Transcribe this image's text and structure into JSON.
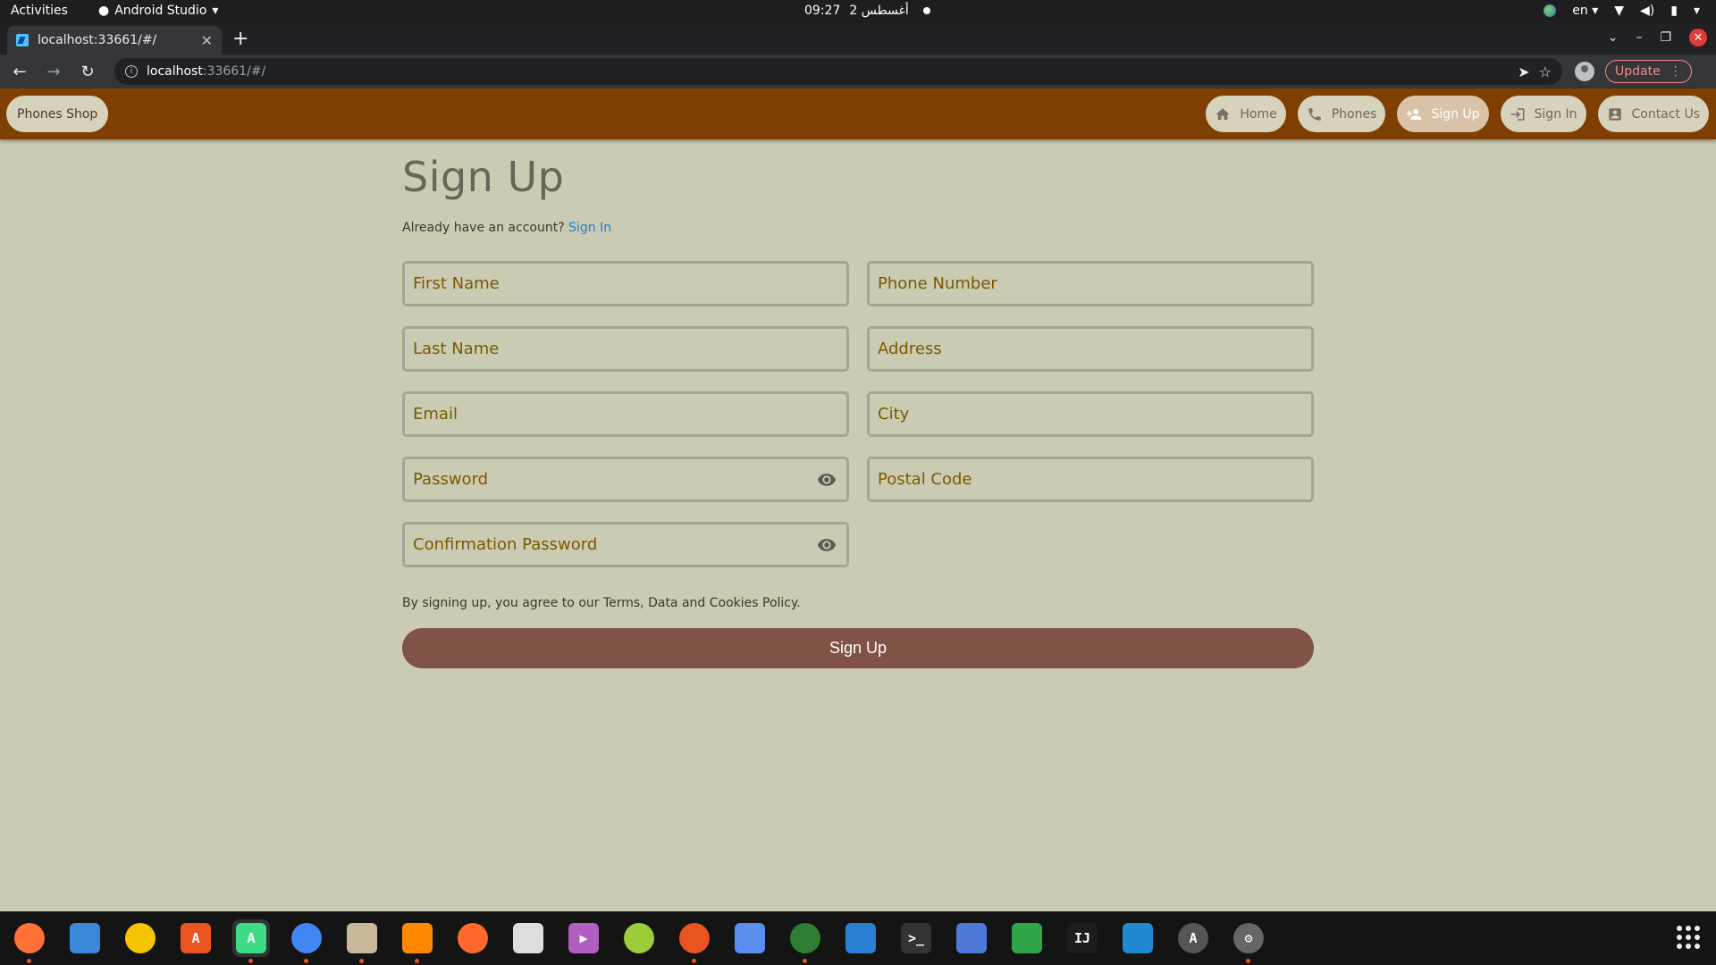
{
  "system_bar": {
    "activities": "Activities",
    "app_menu": "Android Studio",
    "time": "09:27",
    "date": "2 أغسطس",
    "lang": "en"
  },
  "browser": {
    "tab_title": "localhost:33661/#/",
    "url_host": "localhost",
    "url_rest": ":33661/#/",
    "update_label": "Update"
  },
  "navbar": {
    "brand": "Phones Shop",
    "items": [
      {
        "label": "Home",
        "icon": "home-icon"
      },
      {
        "label": "Phones",
        "icon": "phone-icon"
      },
      {
        "label": "Sign Up",
        "icon": "person-add-icon",
        "active": true
      },
      {
        "label": "Sign In",
        "icon": "login-icon"
      },
      {
        "label": "Contact Us",
        "icon": "contact-icon"
      }
    ]
  },
  "form": {
    "title": "Sign Up",
    "already_text": "Already have an account? ",
    "signin_link": "Sign In",
    "fields": {
      "first_name": "First Name",
      "phone_number": "Phone Number",
      "last_name": "Last Name",
      "address": "Address",
      "email": "Email",
      "city": "City",
      "password": "Password",
      "postal_code": "Postal Code",
      "confirmation_password": "Confirmation Password"
    },
    "terms": "By signing up, you agree to our Terms, Data and Cookies Policy.",
    "submit": "Sign Up"
  },
  "colors": {
    "navbar": "#7f3f00",
    "page_bg": "#cbcab2",
    "submit_bg": "#815345",
    "link": "#1a7fd4"
  },
  "dock": [
    {
      "name": "firefox",
      "glyph": "",
      "color": "#ff7139"
    },
    {
      "name": "thunderbird",
      "glyph": "",
      "color": "#3b88d8"
    },
    {
      "name": "rhythmbox",
      "glyph": "",
      "color": "#f5c400"
    },
    {
      "name": "software-center",
      "glyph": "A",
      "color": "#e95420"
    },
    {
      "name": "android-studio",
      "glyph": "A",
      "color": "#3ddc84"
    },
    {
      "name": "chrome",
      "glyph": "",
      "color": "#4285f4"
    },
    {
      "name": "files",
      "glyph": "",
      "color": "#c8b89a"
    },
    {
      "name": "vlc",
      "glyph": "",
      "color": "#ff8800"
    },
    {
      "name": "inkscape",
      "glyph": "",
      "color": "#ff6a2b"
    },
    {
      "name": "document-viewer",
      "glyph": "",
      "color": "#dddddd"
    },
    {
      "name": "videos",
      "glyph": "▶",
      "color": "#b05fc0"
    },
    {
      "name": "android-file-transfer",
      "glyph": "",
      "color": "#9ccc3a"
    },
    {
      "name": "ubuntu-software",
      "glyph": "",
      "color": "#e95420"
    },
    {
      "name": "tasks",
      "glyph": "",
      "color": "#5b8def"
    },
    {
      "name": "system-monitor",
      "glyph": "",
      "color": "#2e7d32"
    },
    {
      "name": "writer",
      "glyph": "",
      "color": "#2a7fd4"
    },
    {
      "name": "terminal",
      "glyph": ">_",
      "color": "#333333"
    },
    {
      "name": "screenshot",
      "glyph": "",
      "color": "#4d79d8"
    },
    {
      "name": "calc",
      "glyph": "",
      "color": "#2fa64a"
    },
    {
      "name": "intellij",
      "glyph": "IJ",
      "color": "#1d1d1d"
    },
    {
      "name": "vscode",
      "glyph": "",
      "color": "#1f8ad2"
    },
    {
      "name": "updates",
      "glyph": "A",
      "color": "#555555"
    },
    {
      "name": "settings",
      "glyph": "⚙",
      "color": "#666666"
    }
  ]
}
